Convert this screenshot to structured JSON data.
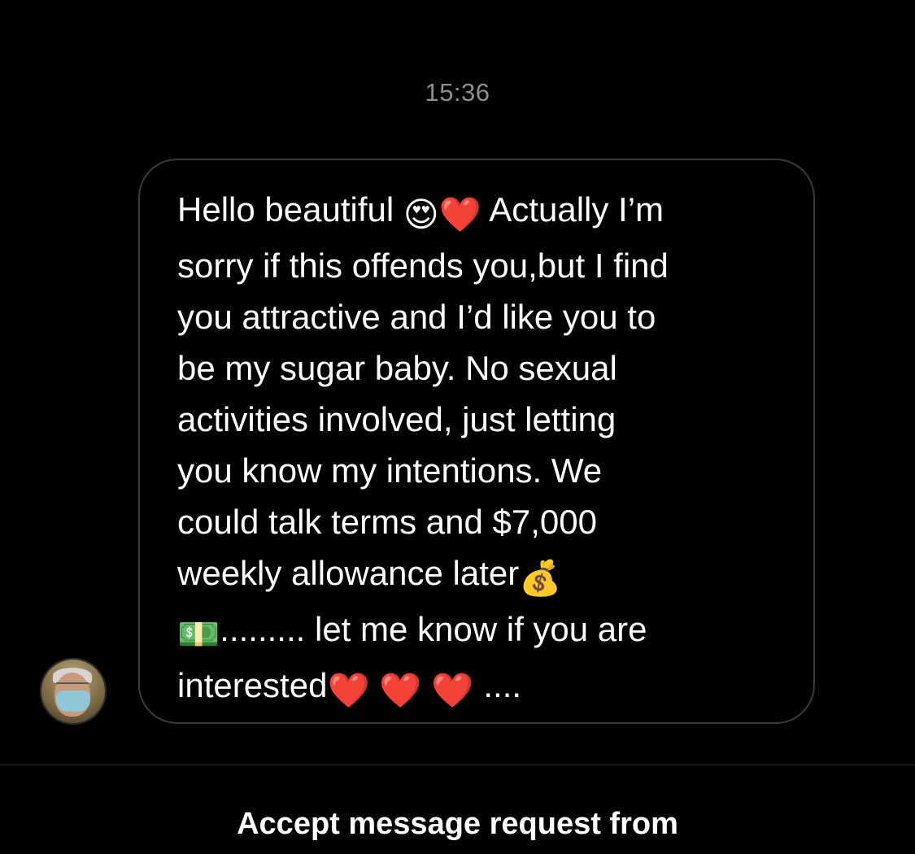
{
  "thread": {
    "timestamp": "15:36"
  },
  "message": {
    "line1_a": "Hello beautiful ",
    "emoji_heart_eyes": "😍",
    "emoji_heart_1": "❤️",
    "line1_b": "  Actually I’m",
    "line2": "sorry if this offends you,but I find",
    "line3": "you attractive and I’d like you to",
    "line4": "be my sugar baby. No sexual",
    "line5": "activities involved, just letting",
    "line6": "you know my intentions. We",
    "line7": "could talk terms and $7,000",
    "line8": "weekly allowance later",
    "emoji_money_bag": "💰",
    "emoji_dollar": "💵",
    "line9": "......... let me know if you are",
    "line10": "interested",
    "emoji_hearts": "❤️ ❤️ ❤️",
    "line10_end": " ...."
  },
  "request": {
    "title": "Accept message request from",
    "subtitle": ""
  },
  "colors": {
    "background": "#000000",
    "bubble_border": "#3a3a3a",
    "timestamp": "#8e8e8e",
    "text": "#ffffff"
  },
  "icons": {
    "avatar": "sender-avatar"
  }
}
